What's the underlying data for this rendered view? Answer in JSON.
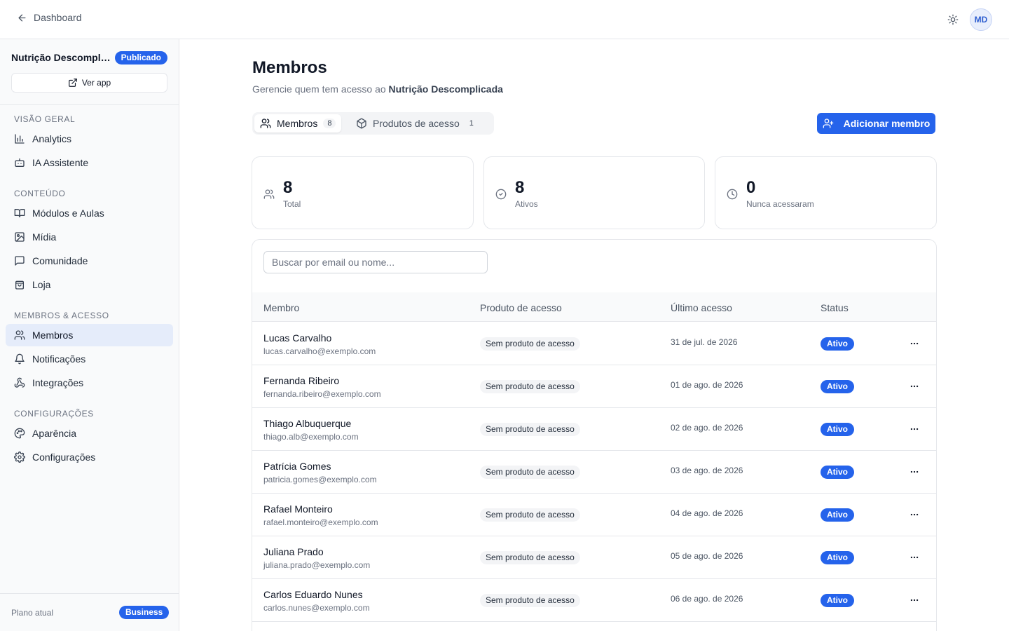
{
  "topbar": {
    "back_label": "Dashboard",
    "avatar_initials": "MD"
  },
  "sidebar": {
    "app_name": "Nutrição Descomplicada",
    "status_badge": "Publicado",
    "view_app_label": "Ver app",
    "sections": [
      {
        "label": "VISÃO GERAL",
        "items": [
          {
            "label": "Analytics",
            "icon": "bar-chart-icon"
          },
          {
            "label": "IA Assistente",
            "icon": "bot-icon"
          }
        ]
      },
      {
        "label": "CONTEÚDO",
        "items": [
          {
            "label": "Módulos e Aulas",
            "icon": "book-open-icon"
          },
          {
            "label": "Mídia",
            "icon": "image-icon"
          },
          {
            "label": "Comunidade",
            "icon": "message-square-icon"
          },
          {
            "label": "Loja",
            "icon": "shopping-bag-icon"
          }
        ]
      },
      {
        "label": "MEMBROS & ACESSO",
        "items": [
          {
            "label": "Membros",
            "icon": "users-icon",
            "active": true
          },
          {
            "label": "Notificações",
            "icon": "bell-icon"
          },
          {
            "label": "Integrações",
            "icon": "webhook-icon"
          }
        ]
      },
      {
        "label": "CONFIGURAÇÕES",
        "items": [
          {
            "label": "Aparência",
            "icon": "palette-icon"
          },
          {
            "label": "Configurações",
            "icon": "settings-icon"
          }
        ]
      }
    ],
    "plan_label": "Plano atual",
    "plan_badge": "Business"
  },
  "main": {
    "title": "Membros",
    "subtitle_prefix": "Gerencie quem tem acesso ao ",
    "subtitle_app": "Nutrição Descomplicada",
    "tabs": [
      {
        "label": "Membros",
        "count": "8",
        "active": true
      },
      {
        "label": "Produtos de acesso",
        "count": "1",
        "active": false
      }
    ],
    "add_member_label": "Adicionar membro",
    "stats": [
      {
        "value": "8",
        "label": "Total",
        "icon": "users-icon"
      },
      {
        "value": "8",
        "label": "Ativos",
        "icon": "check-circle-icon"
      },
      {
        "value": "0",
        "label": "Nunca acessaram",
        "icon": "clock-icon"
      }
    ],
    "search_placeholder": "Buscar por email ou nome...",
    "columns": [
      "Membro",
      "Produto de acesso",
      "Último acesso",
      "Status"
    ],
    "rows": [
      {
        "name": "Lucas Carvalho",
        "email": "lucas.carvalho@exemplo.com",
        "product": "Sem produto de acesso",
        "last_access": "31 de jul. de 2026",
        "status": "Ativo"
      },
      {
        "name": "Fernanda Ribeiro",
        "email": "fernanda.ribeiro@exemplo.com",
        "product": "Sem produto de acesso",
        "last_access": "01 de ago. de 2026",
        "status": "Ativo"
      },
      {
        "name": "Thiago Albuquerque",
        "email": "thiago.alb@exemplo.com",
        "product": "Sem produto de acesso",
        "last_access": "02 de ago. de 2026",
        "status": "Ativo"
      },
      {
        "name": "Patrícia Gomes",
        "email": "patricia.gomes@exemplo.com",
        "product": "Sem produto de acesso",
        "last_access": "03 de ago. de 2026",
        "status": "Ativo"
      },
      {
        "name": "Rafael Monteiro",
        "email": "rafael.monteiro@exemplo.com",
        "product": "Sem produto de acesso",
        "last_access": "04 de ago. de 2026",
        "status": "Ativo"
      },
      {
        "name": "Juliana Prado",
        "email": "juliana.prado@exemplo.com",
        "product": "Sem produto de acesso",
        "last_access": "05 de ago. de 2026",
        "status": "Ativo"
      },
      {
        "name": "Carlos Eduardo Nunes",
        "email": "carlos.nunes@exemplo.com",
        "product": "Sem produto de acesso",
        "last_access": "06 de ago. de 2026",
        "status": "Ativo"
      }
    ]
  },
  "colors": {
    "accent": "#2563eb",
    "active_nav_bg": "#e5ecfa",
    "border": "#e5e7eb",
    "muted_text": "#6b7280"
  }
}
